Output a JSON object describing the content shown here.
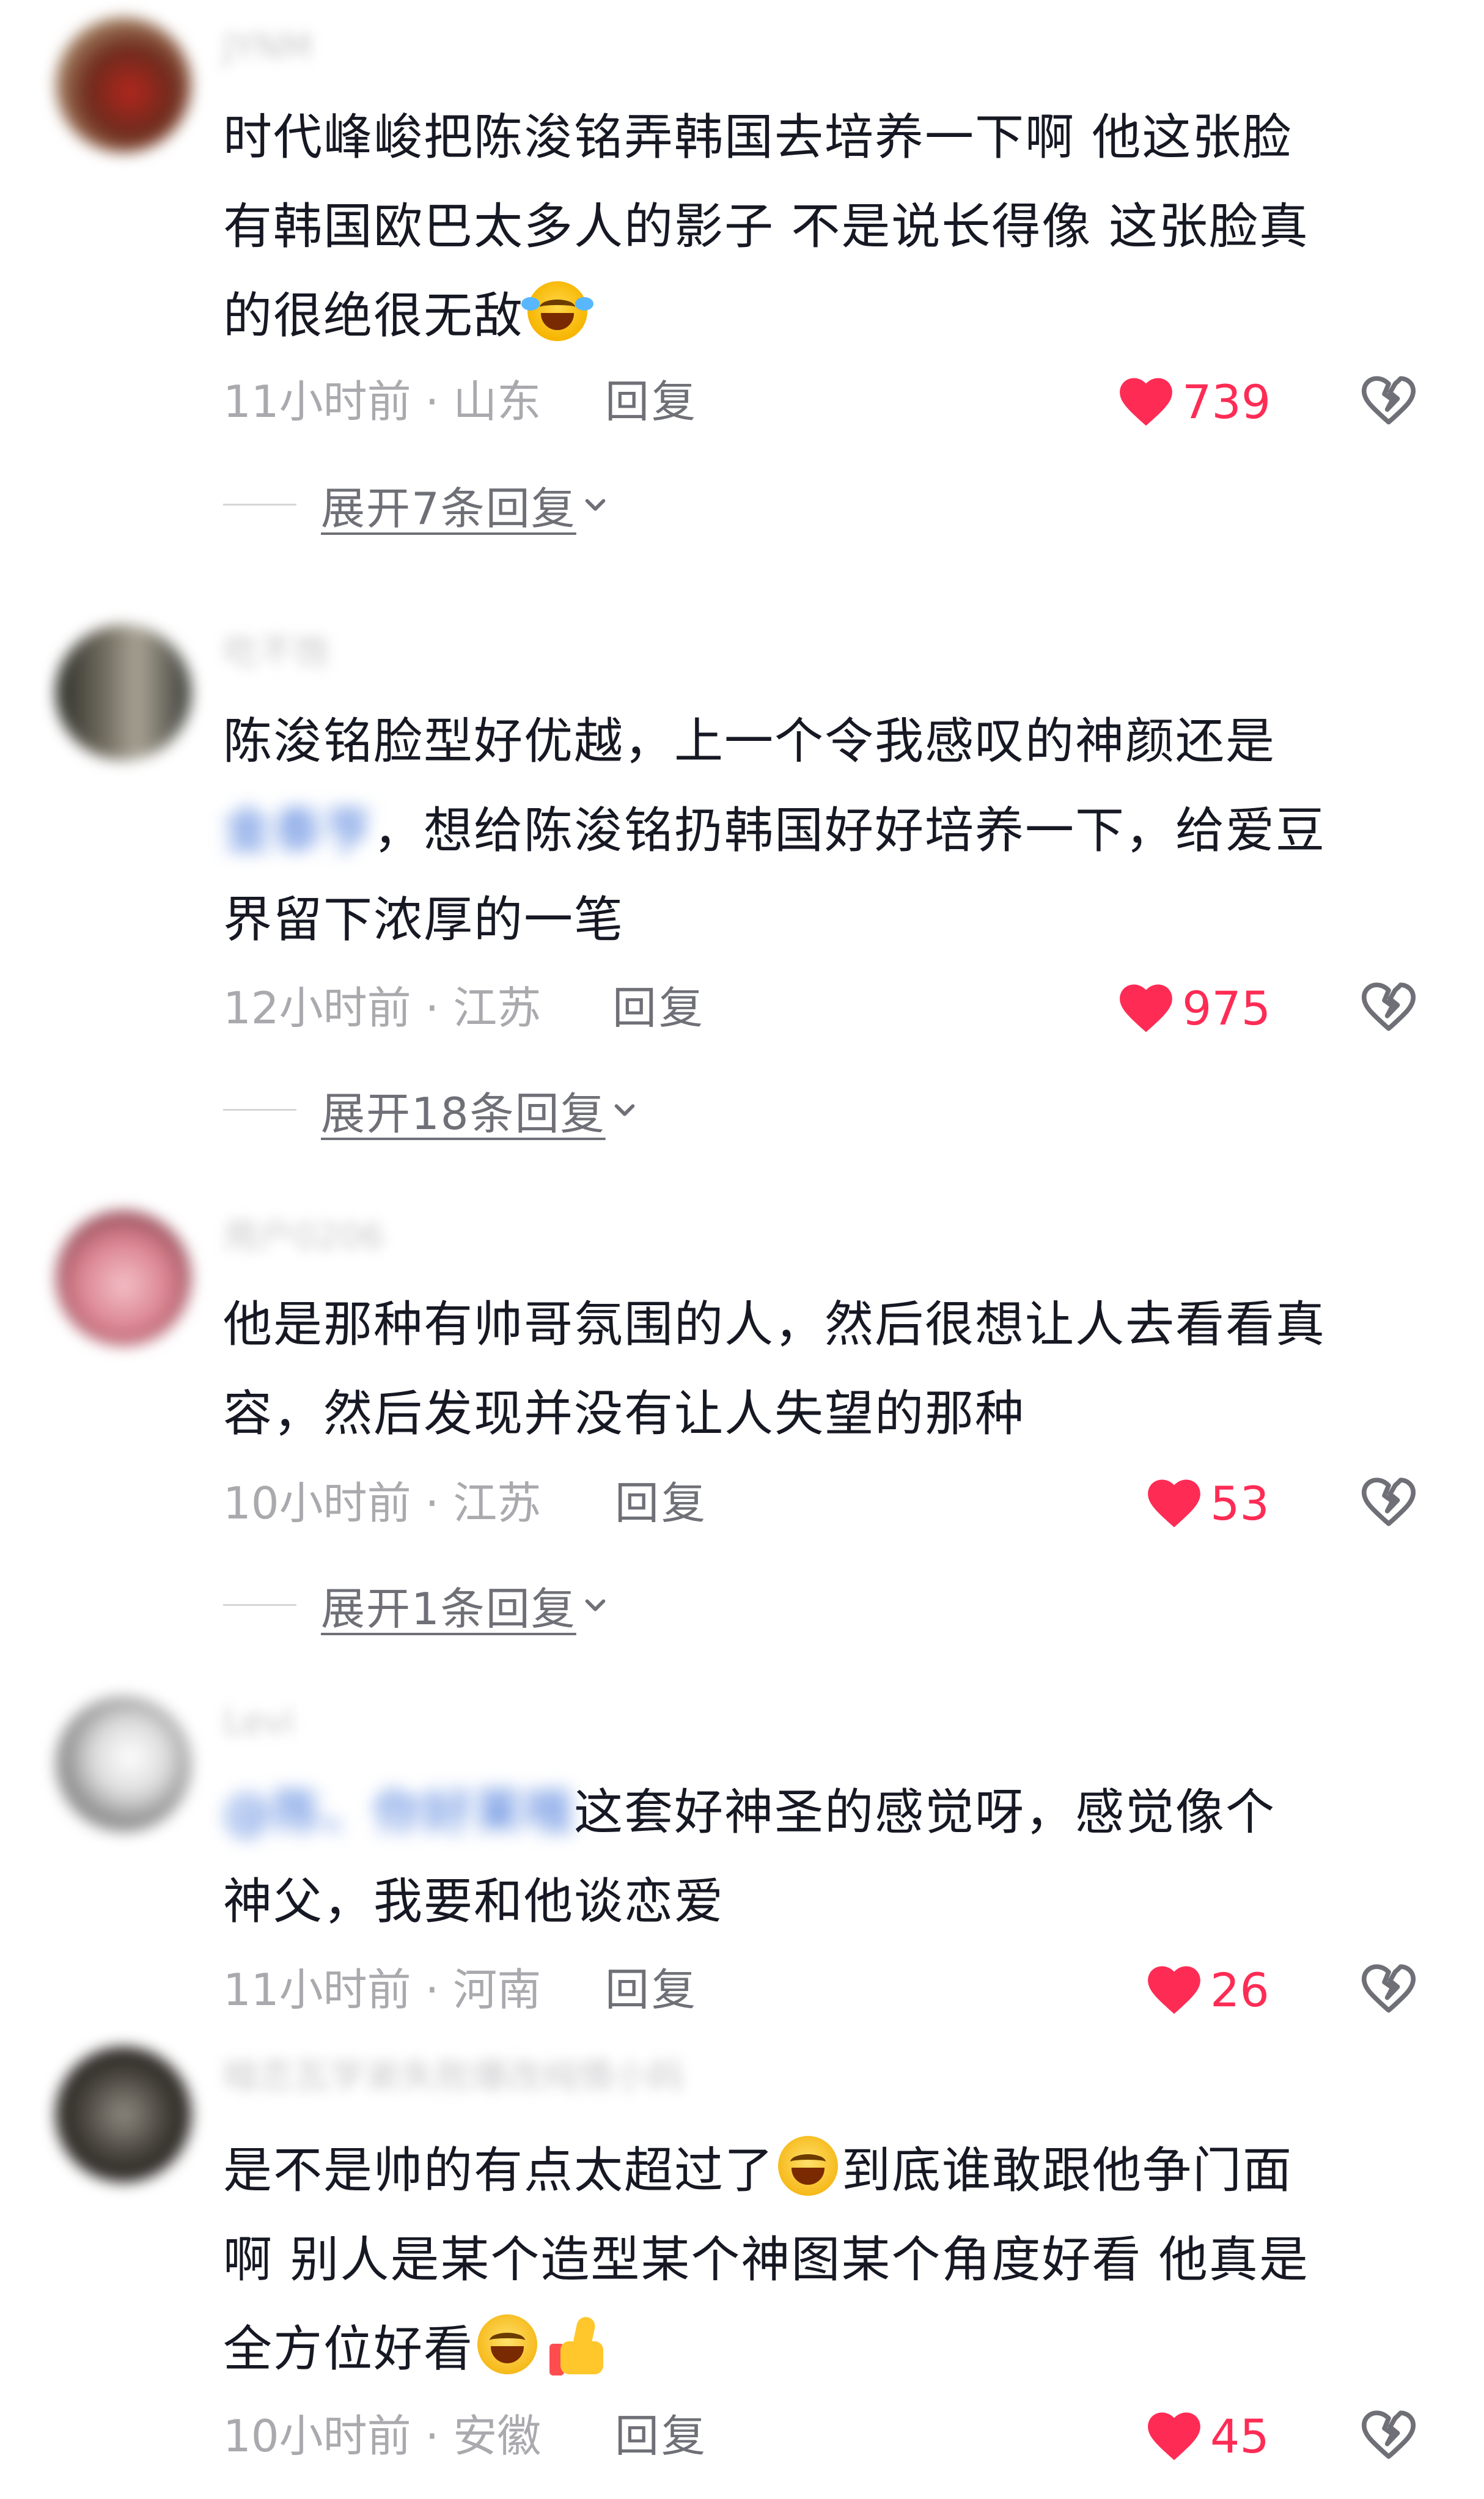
{
  "comments": [
    {
      "username": "JYNM",
      "text": [
        "时代峰峻把陈浚铭弄韩国去培养一下啊 他这张脸",
        "有韩国欧巴太多人的影子 不是说长得像 这张脸真",
        "的很绝很无敌"
      ],
      "time_location": "11小时前 · 山东",
      "reply_label": "回复",
      "likes": "739",
      "expand_label": "展开7条回复"
    },
    {
      "username": "吃不饱",
      "text_line1": "陈浚铭脸型好优越，上一个令我感叹的神颜还是",
      "mention": "金泰亨",
      "text_line2_rest": "，想给陈浚铭扔韩国好好培养一下，给爱豆",
      "text_line3": "界留下浓厚的一笔",
      "time_location": "12小时前 · 江苏",
      "reply_label": "回复",
      "likes": "975",
      "expand_label": "展开18条回复"
    },
    {
      "username": "用户0206",
      "text": [
        "他是那种有帅哥氛围的人，然后很想让人去看看真",
        "容，然后发现并没有让人失望的那种"
      ],
      "time_location": "10小时前 · 江苏",
      "reply_label": "回复",
      "likes": "53",
      "expand_label": "展开1条回复"
    },
    {
      "username": "Levi",
      "mention": "@陈、你好莱哦",
      "text_line1_rest": "这套好神圣的感觉呀，感觉像个",
      "text_line2": "神父，我要和他谈恋爱",
      "time_location": "11小时前 · 河南",
      "reply_label": "回复",
      "likes": "26"
    },
    {
      "username": "暗恋瓦学弟失败爆改纯情小妈",
      "text": [
        "是不是帅的有点太超过了",
        "到底谁敢跟他争门面",
        "啊 别人是某个造型某个神图某个角度好看 他真是",
        "全方位好看"
      ],
      "time_location": "10小时前 · 安徽",
      "reply_label": "回复",
      "likes": "45"
    }
  ],
  "icons": {
    "heart": "filled-heart-icon",
    "dislike": "broken-heart-icon",
    "chevron": "chevron-down-icon"
  },
  "colors": {
    "like_red": "#fe2c55",
    "meta_gray": "#a9a9ae",
    "text_dark": "#161823",
    "mention_blue": "#3a6fd8"
  }
}
